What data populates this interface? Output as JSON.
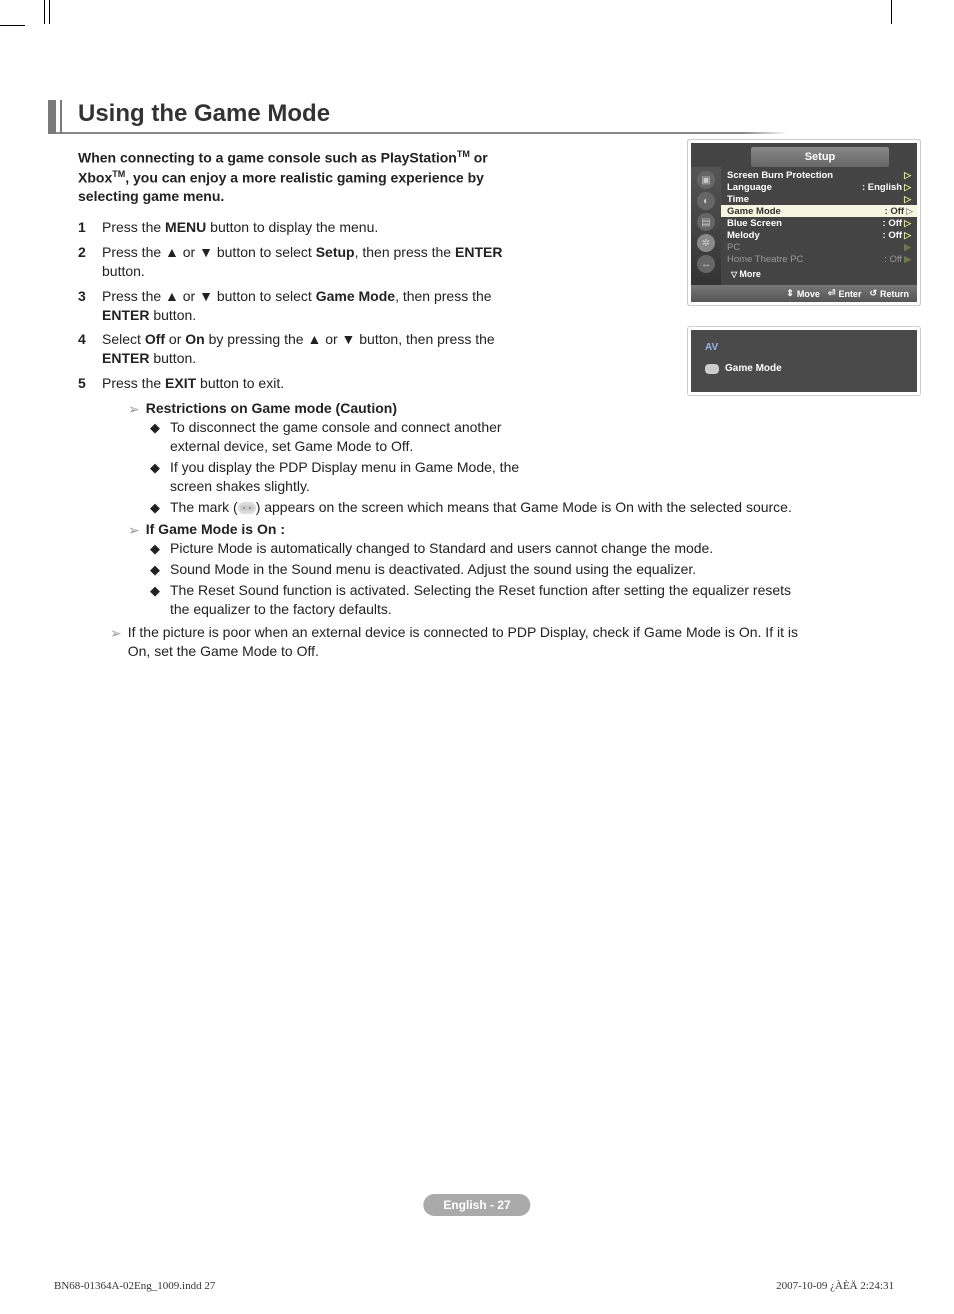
{
  "title": "Using the Game Mode",
  "intro_pre": "When connecting to a game console such as PlayStation",
  "intro_tm1": "TM",
  "intro_mid": " or Xbox",
  "intro_tm2": "TM",
  "intro_post": ", you can enjoy a more realistic gaming experience by selecting game menu.",
  "steps": [
    {
      "n": "1",
      "pre": "Press the ",
      "b1": "MENU",
      "post1": " button to display the menu."
    },
    {
      "n": "2",
      "pre": "Press the ▲ or ▼ button to select ",
      "b1": "Setup",
      "post1": ", then press the ",
      "b2": "ENTER",
      "post2": " button."
    },
    {
      "n": "3",
      "pre": "Press the ▲ or ▼ button to select ",
      "b1": "Game Mode",
      "post1": ", then press the ",
      "b2": "ENTER",
      "post2": " button."
    },
    {
      "n": "4",
      "pre": "Select ",
      "b1": "Off",
      "mid": " or ",
      "b2": "On",
      "post1": " by pressing the ▲ or ▼ button, then press the ",
      "b3": "ENTER",
      "post2": " button."
    },
    {
      "n": "5",
      "pre": "Press the ",
      "b1": "EXIT",
      "post1": " button to exit."
    }
  ],
  "restrict_title": "Restrictions on Game mode (Caution)",
  "restrict_items": [
    "To disconnect the game console and connect another external device, set Game Mode to Off.",
    "If you display the PDP Display menu in Game Mode, the screen shakes slightly."
  ],
  "restrict_mark_pre": "The mark (",
  "restrict_mark_post": ") appears on the screen which means that Game Mode is On with the selected source.",
  "gmon_title": "If Game Mode is On :",
  "gmon_items": [
    "Picture Mode is automatically changed to Standard and users cannot change the mode.",
    "Sound Mode in the Sound menu is deactivated. Adjust the sound using the equalizer.",
    "The Reset Sound function is activated. Selecting the Reset function after setting the equalizer resets the equalizer to the factory defaults."
  ],
  "poor_pic": "If the picture is poor when an external device is connected to PDP Display, check if Game Mode is On. If it is On, set the Game Mode to Off.",
  "osd": {
    "title": "Setup",
    "rows": [
      {
        "lbl": "Screen Burn Protection",
        "val": "",
        "hl": false
      },
      {
        "lbl": "Language",
        "val": ": English",
        "hl": false
      },
      {
        "lbl": "Time",
        "val": "",
        "hl": false
      },
      {
        "lbl": "Game Mode",
        "val": ": Off",
        "hl": true
      },
      {
        "lbl": "Blue Screen",
        "val": ": Off",
        "hl": false
      },
      {
        "lbl": "Melody",
        "val": ": Off",
        "hl": false
      },
      {
        "lbl": "PC",
        "val": "",
        "hl": false,
        "dim": true
      },
      {
        "lbl": "Home Theatre PC",
        "val": ": Off",
        "hl": false,
        "dim": true
      }
    ],
    "more": "More",
    "move": "Move",
    "enter": "Enter",
    "return": "Return"
  },
  "osd2": {
    "av": "AV",
    "gm": "Game Mode"
  },
  "page_label": "English - 27",
  "foot_left": "BN68-01364A-02Eng_1009.indd   27",
  "foot_right": "2007-10-09   ¿ÀÈÄ 2:24:31"
}
